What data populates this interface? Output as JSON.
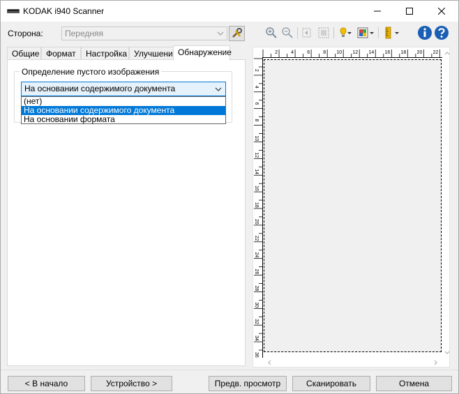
{
  "window": {
    "title": "KODAK i940 Scanner",
    "controls": {
      "minimize": "minimize",
      "maximize": "maximize",
      "close": "close"
    }
  },
  "toolbar": {
    "side_label": "Сторона:",
    "side_value": "Передняя",
    "icons": [
      "settings-wrench-icon",
      "zoom-in-icon",
      "zoom-out-icon",
      "rotate-icon",
      "fit-icon",
      "lamp-icon",
      "color-icon",
      "ruler-icon",
      "info-icon",
      "help-icon"
    ]
  },
  "tabs": [
    {
      "label": "Общие"
    },
    {
      "label": "Формат"
    },
    {
      "label": "Настройка"
    },
    {
      "label": "Улучшение"
    },
    {
      "label": "Обнаружение"
    }
  ],
  "active_tab": "Обнаружение",
  "detection": {
    "group_title": "Определение пустого изображения",
    "combo_value": "На основании содержимого документа",
    "options": [
      {
        "label": "(нет)",
        "selected": false
      },
      {
        "label": "На основании содержимого документа",
        "selected": true
      },
      {
        "label": "На основании формата",
        "selected": false
      }
    ]
  },
  "preview": {
    "ruler_h": [
      "2",
      "4",
      "6",
      "8",
      "10",
      "12",
      "14",
      "16",
      "18",
      "20",
      "22"
    ],
    "ruler_v": [
      "2",
      "4",
      "6",
      "8",
      "10",
      "12",
      "14",
      "16",
      "18",
      "20",
      "22",
      "24",
      "26",
      "28",
      "30",
      "32",
      "34",
      "36"
    ]
  },
  "buttons": {
    "back": "< В начало",
    "device": "Устройство >",
    "preview": "Предв. просмотр",
    "scan": "Сканировать",
    "cancel": "Отмена"
  },
  "colors": {
    "accent": "#0078d7",
    "selection_bg": "#0078d7",
    "combo_bg": "#e5f1fb",
    "info_blue": "#1a5fb4"
  }
}
